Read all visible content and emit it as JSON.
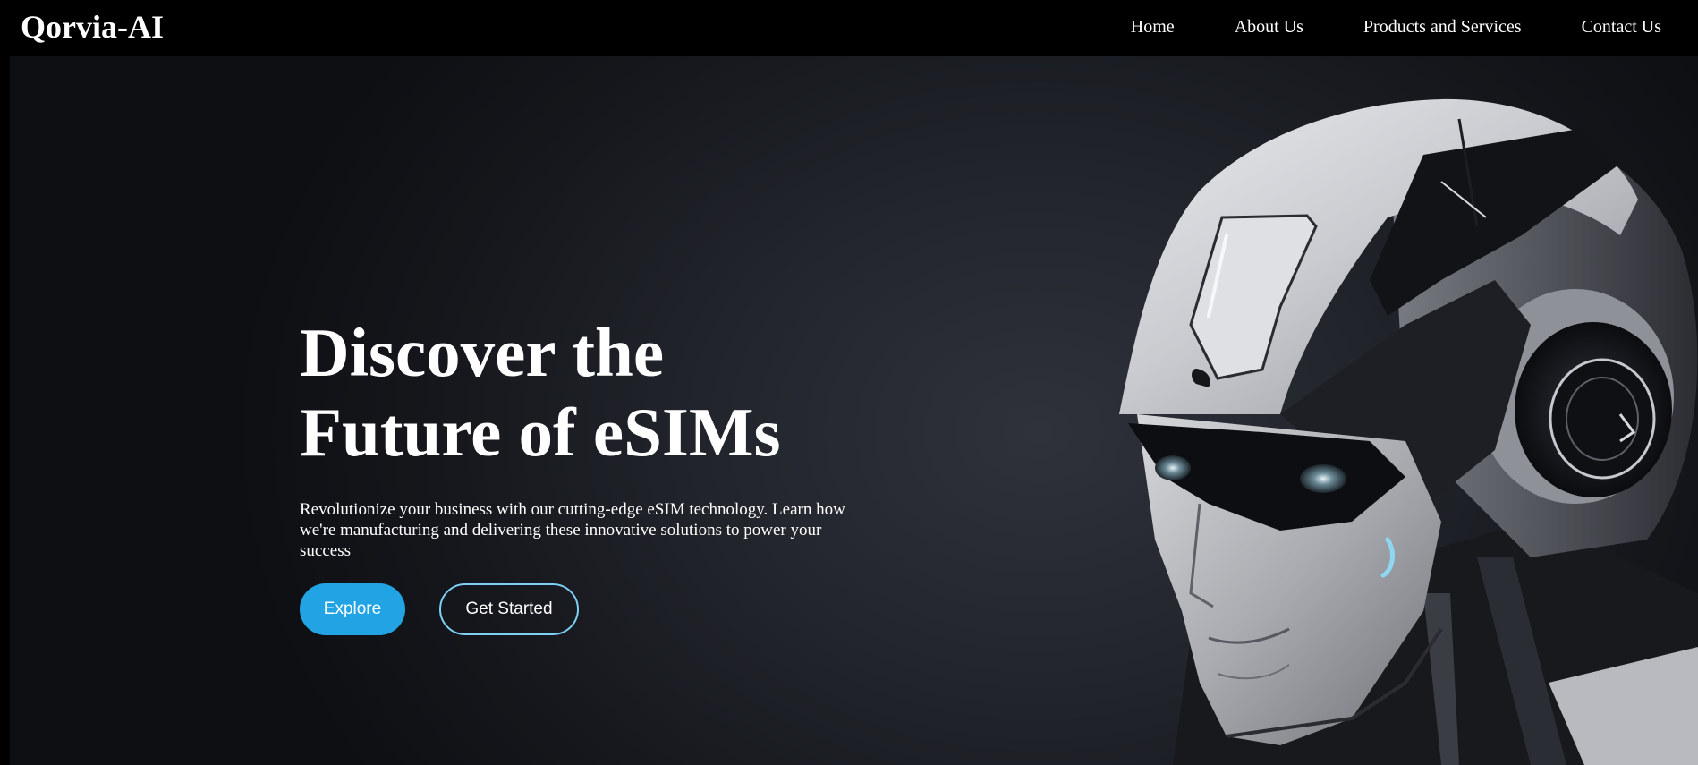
{
  "brand": {
    "name": "Qorvia-AI"
  },
  "nav": {
    "items": [
      {
        "label": "Home"
      },
      {
        "label": "About Us"
      },
      {
        "label": "Products and Services"
      },
      {
        "label": "Contact Us"
      }
    ]
  },
  "hero": {
    "title": "Discover the Future of eSIMs",
    "description": "Revolutionize your business with our cutting-edge eSIM technology. Learn how we're manufacturing and delivering these innovative solutions to power your success",
    "buttons": {
      "primary": "Explore",
      "secondary": "Get Started"
    },
    "image": "robot-head-illustration"
  },
  "colors": {
    "background": "#000000",
    "accent": "#22a4e4",
    "outline": "#7fd0f5",
    "text": "#ffffff"
  }
}
